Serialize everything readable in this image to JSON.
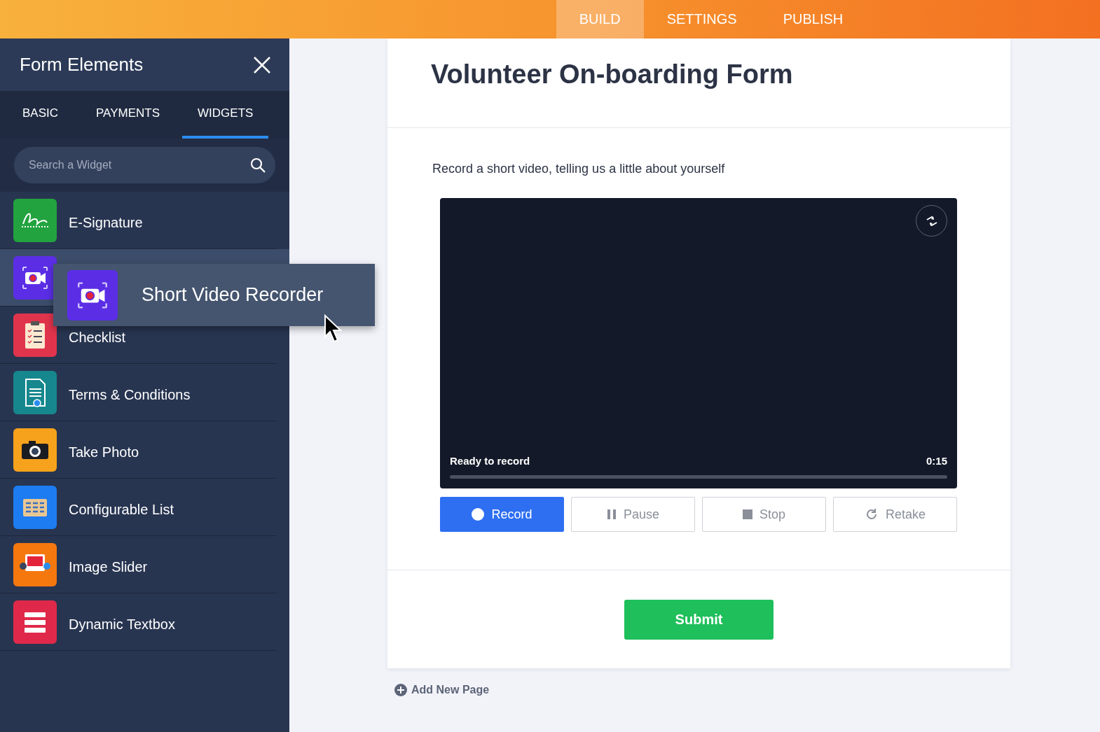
{
  "top_nav": [
    {
      "label": "BUILD",
      "selected": true
    },
    {
      "label": "SETTINGS",
      "selected": false
    },
    {
      "label": "PUBLISH",
      "selected": false
    }
  ],
  "panel": {
    "title": "Form Elements",
    "tabs": [
      {
        "label": "BASIC",
        "selected": false
      },
      {
        "label": "PAYMENTS",
        "selected": false
      },
      {
        "label": "WIDGETS",
        "selected": true
      }
    ],
    "search": {
      "placeholder": "Search a Widget"
    },
    "widgets": [
      {
        "kind": "signature",
        "label": "E-Signature",
        "highlighted": false
      },
      {
        "kind": "video",
        "highlighted": true
      },
      {
        "kind": "checklist",
        "label": "Checklist",
        "highlighted": false
      },
      {
        "kind": "terms",
        "label": "Terms & Conditions",
        "highlighted": false
      },
      {
        "kind": "photo",
        "label": "Take Photo",
        "highlighted": false
      },
      {
        "kind": "list",
        "label": "Configurable List",
        "highlighted": false
      },
      {
        "kind": "slider",
        "label": "Image Slider",
        "highlighted": false
      },
      {
        "kind": "textbox",
        "label": "Dynamic Textbox",
        "highlighted": false
      }
    ],
    "drag_item": {
      "kind": "video",
      "label": "Short Video Recorder"
    }
  },
  "form": {
    "title": "Volunteer On-boarding Form",
    "question": "Record a short video, telling us a little about yourself",
    "recorder": {
      "status": "Ready to record",
      "time": "0:15",
      "buttons": [
        {
          "kind": "record",
          "label": "Record",
          "active": true
        },
        {
          "kind": "pause",
          "label": "Pause",
          "active": false
        },
        {
          "kind": "stop",
          "label": "Stop",
          "active": false
        },
        {
          "kind": "retake",
          "label": "Retake",
          "active": false
        }
      ]
    },
    "submit": "Submit"
  },
  "add_page": "Add New Page"
}
